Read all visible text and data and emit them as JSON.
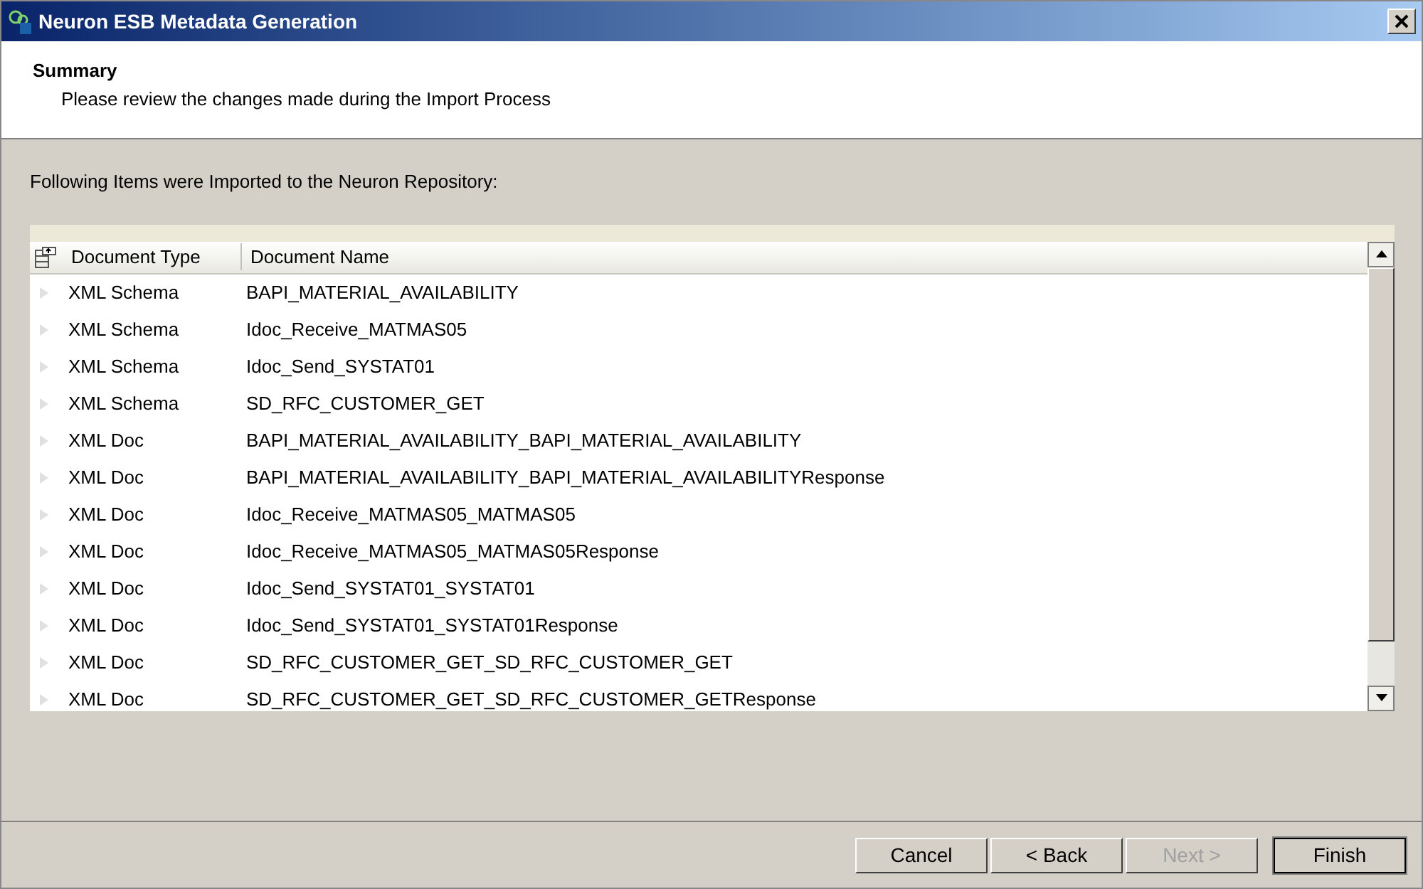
{
  "window": {
    "title": "Neuron ESB Metadata Generation"
  },
  "header": {
    "title": "Summary",
    "subtitle": "Please review the changes made during the Import Process"
  },
  "intro": "Following Items were Imported to the Neuron Repository:",
  "table": {
    "columns": [
      "Document Type",
      "Document Name"
    ],
    "rows": [
      [
        "XML Schema",
        "BAPI_MATERIAL_AVAILABILITY"
      ],
      [
        "XML Schema",
        "Idoc_Receive_MATMAS05"
      ],
      [
        "XML Schema",
        "Idoc_Send_SYSTAT01"
      ],
      [
        "XML Schema",
        "SD_RFC_CUSTOMER_GET"
      ],
      [
        "XML Doc",
        "BAPI_MATERIAL_AVAILABILITY_BAPI_MATERIAL_AVAILABILITY"
      ],
      [
        "XML Doc",
        "BAPI_MATERIAL_AVAILABILITY_BAPI_MATERIAL_AVAILABILITYResponse"
      ],
      [
        "XML Doc",
        "Idoc_Receive_MATMAS05_MATMAS05"
      ],
      [
        "XML Doc",
        "Idoc_Receive_MATMAS05_MATMAS05Response"
      ],
      [
        "XML Doc",
        "Idoc_Send_SYSTAT01_SYSTAT01"
      ],
      [
        "XML Doc",
        "Idoc_Send_SYSTAT01_SYSTAT01Response"
      ],
      [
        "XML Doc",
        "SD_RFC_CUSTOMER_GET_SD_RFC_CUSTOMER_GET"
      ],
      [
        "XML Doc",
        "SD_RFC_CUSTOMER_GET_SD_RFC_CUSTOMER_GETResponse"
      ]
    ]
  },
  "buttons": [
    {
      "label": "Cancel",
      "disabled": false,
      "default": false
    },
    {
      "label": "< Back",
      "disabled": false,
      "default": false
    },
    {
      "label": "Next >",
      "disabled": true,
      "default": false
    },
    {
      "label": "Finish",
      "disabled": false,
      "default": true
    }
  ]
}
